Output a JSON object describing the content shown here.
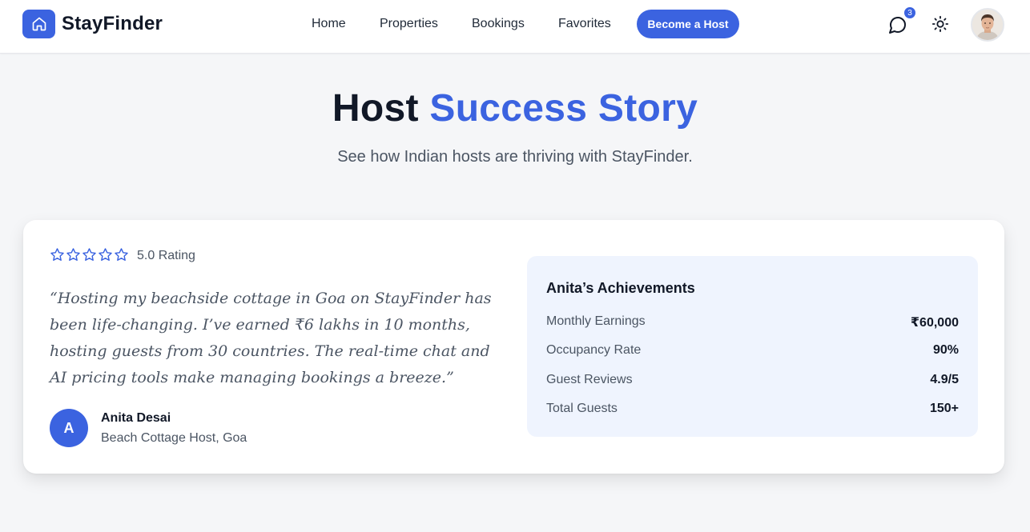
{
  "header": {
    "brand": "StayFinder",
    "nav": [
      "Home",
      "Properties",
      "Bookings",
      "Favorites"
    ],
    "cta": "Become a Host",
    "chat_badge": "3",
    "icons": [
      "home-icon",
      "chat-icon",
      "sun-icon",
      "avatar"
    ]
  },
  "hero": {
    "title_plain": "Host ",
    "title_accent": "Success Story",
    "subtitle": "See how Indian hosts are thriving with StayFinder."
  },
  "testimonial": {
    "stars": 5,
    "rating_text": "5.0 Rating",
    "quote": "“Hosting my beachside cottage in Goa on StayFinder has been life-changing. I’ve earned ₹6 lakhs in 10 months, hosting guests from 30 countries. The real-time chat and AI pricing tools make managing bookings a breeze.”",
    "author_initial": "A",
    "author_name": "Anita Desai",
    "author_role": "Beach Cottage Host, Goa"
  },
  "achievements": {
    "title": "Anita’s Achievements",
    "stats": [
      {
        "label": "Monthly Earnings",
        "value": "₹60,000"
      },
      {
        "label": "Occupancy Rate",
        "value": "90%"
      },
      {
        "label": "Guest Reviews",
        "value": "4.9/5"
      },
      {
        "label": "Total Guests",
        "value": "150+"
      }
    ]
  },
  "colors": {
    "accent": "#3b63e0",
    "background": "#f5f6f8",
    "panel": "#eff4fe"
  }
}
